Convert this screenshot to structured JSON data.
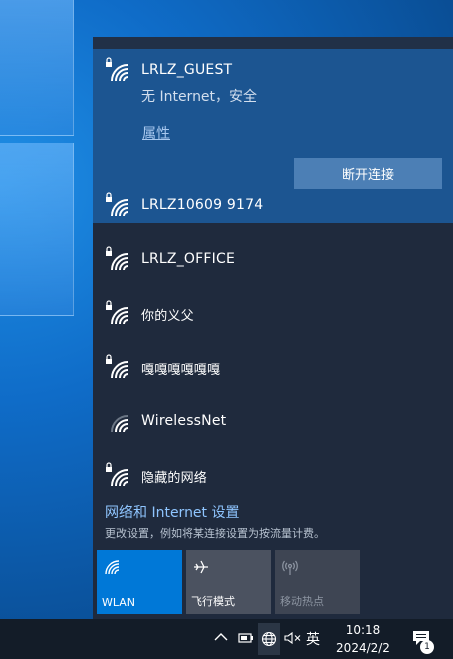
{
  "connected_network": {
    "name": "LRLZ_GUEST",
    "status": "无 Internet，安全",
    "properties_link": "属性",
    "disconnect_button": "断开连接"
  },
  "networks": [
    {
      "name": "LRLZ10609 9174",
      "secured": true
    },
    {
      "name": "LRLZ_OFFICE",
      "secured": true
    },
    {
      "name": "你的义父",
      "secured": true
    },
    {
      "name": "嘎嘎嘎嘎嘎嘎",
      "secured": true
    },
    {
      "name": "WirelessNet",
      "secured": false
    },
    {
      "name": "隐藏的网络",
      "secured": true
    }
  ],
  "settings": {
    "title": "网络和 Internet 设置",
    "description": "更改设置，例如将某连接设置为按流量计费。"
  },
  "tiles": [
    {
      "label": "WLAN",
      "icon": "wifi-icon",
      "active": true
    },
    {
      "label": "飞行模式",
      "icon": "airplane-icon",
      "active": false
    },
    {
      "label": "移动热点",
      "icon": "hotspot-icon",
      "active": false
    }
  ],
  "taskbar": {
    "ime_label": "英",
    "time": "10:18",
    "date": "2024/2/2",
    "notification_count": "1"
  },
  "colors": {
    "accent": "#0078d7",
    "flyout_bg": "#1f2a3d",
    "connected_bg": "#1c5591",
    "link": "#8fc5ff"
  }
}
